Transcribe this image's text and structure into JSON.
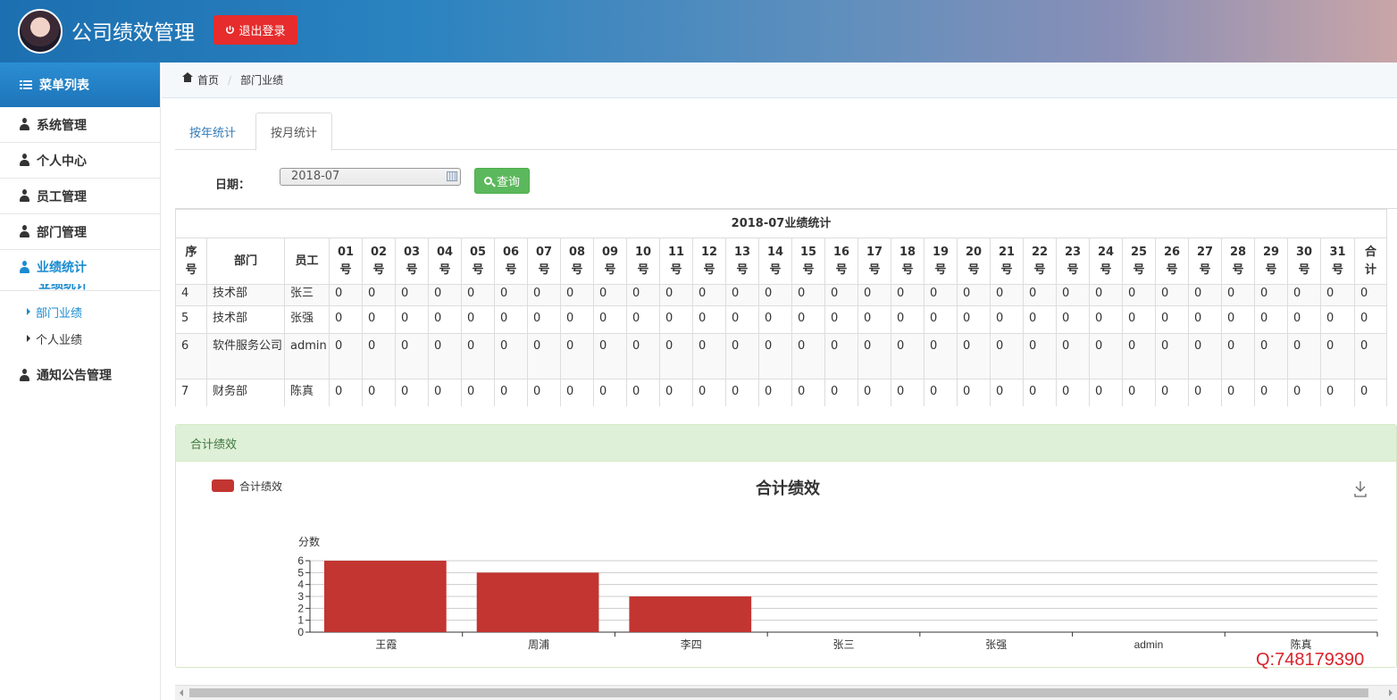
{
  "header": {
    "title": "公司绩效管理",
    "logout_label": "退出登录"
  },
  "sidebar": {
    "menu_title": "菜单列表",
    "items": [
      {
        "label": "系统管理"
      },
      {
        "label": "个人中心"
      },
      {
        "label": "员工管理"
      },
      {
        "label": "部门管理"
      },
      {
        "label": "业绩统计"
      }
    ],
    "cut_label": "业绩统计",
    "sub_items": [
      {
        "label": "部门业绩"
      },
      {
        "label": "个人业绩"
      }
    ],
    "last_item": "通知公告管理"
  },
  "breadcrumb": {
    "home": "首页",
    "current": "部门业绩"
  },
  "tabs": [
    {
      "label": "按年统计"
    },
    {
      "label": "按月统计"
    }
  ],
  "filter": {
    "date_label": "日期：",
    "date_value": "2018-07",
    "query_label": "查询"
  },
  "table": {
    "caption": "2018-07业绩统计",
    "col_no": "序号",
    "col_dept": "部门",
    "col_emp": "员工",
    "day_suffix": "号",
    "days": [
      "01",
      "02",
      "03",
      "04",
      "05",
      "06",
      "07",
      "08",
      "09",
      "10",
      "11",
      "12",
      "13",
      "14",
      "15",
      "16",
      "17",
      "18",
      "19",
      "20",
      "21",
      "22",
      "23",
      "24",
      "25",
      "26",
      "27",
      "28",
      "29",
      "30",
      "31"
    ],
    "col_total": "合计",
    "rows": [
      {
        "no": "4",
        "dept": "技术部",
        "emp": "张三"
      },
      {
        "no": "5",
        "dept": "技术部",
        "emp": "张强"
      },
      {
        "no": "6",
        "dept": "软件服务公司",
        "emp": "admin"
      },
      {
        "no": "7",
        "dept": "财务部",
        "emp": "陈真"
      }
    ],
    "cell_value": "0"
  },
  "panel": {
    "title": "合计绩效"
  },
  "chart_data": {
    "type": "bar",
    "title": "合计绩效",
    "ylabel": "分数",
    "categories": [
      "王霞",
      "周浦",
      "李四",
      "张三",
      "张强",
      "admin",
      "陈真"
    ],
    "series": [
      {
        "name": "合计绩效",
        "values": [
          6,
          5,
          3,
          0,
          0,
          0,
          0
        ],
        "color": "#c23531"
      }
    ],
    "ylim": [
      0,
      6
    ],
    "yticks": [
      0,
      1,
      2,
      3,
      4,
      5,
      6
    ],
    "grid": true,
    "legend": "top-left"
  },
  "watermark": "Q:748179390",
  "colors": {
    "primary": "#1a8bd0",
    "danger": "#e62c2c",
    "success": "#5cb85c",
    "bar": "#c23531"
  }
}
